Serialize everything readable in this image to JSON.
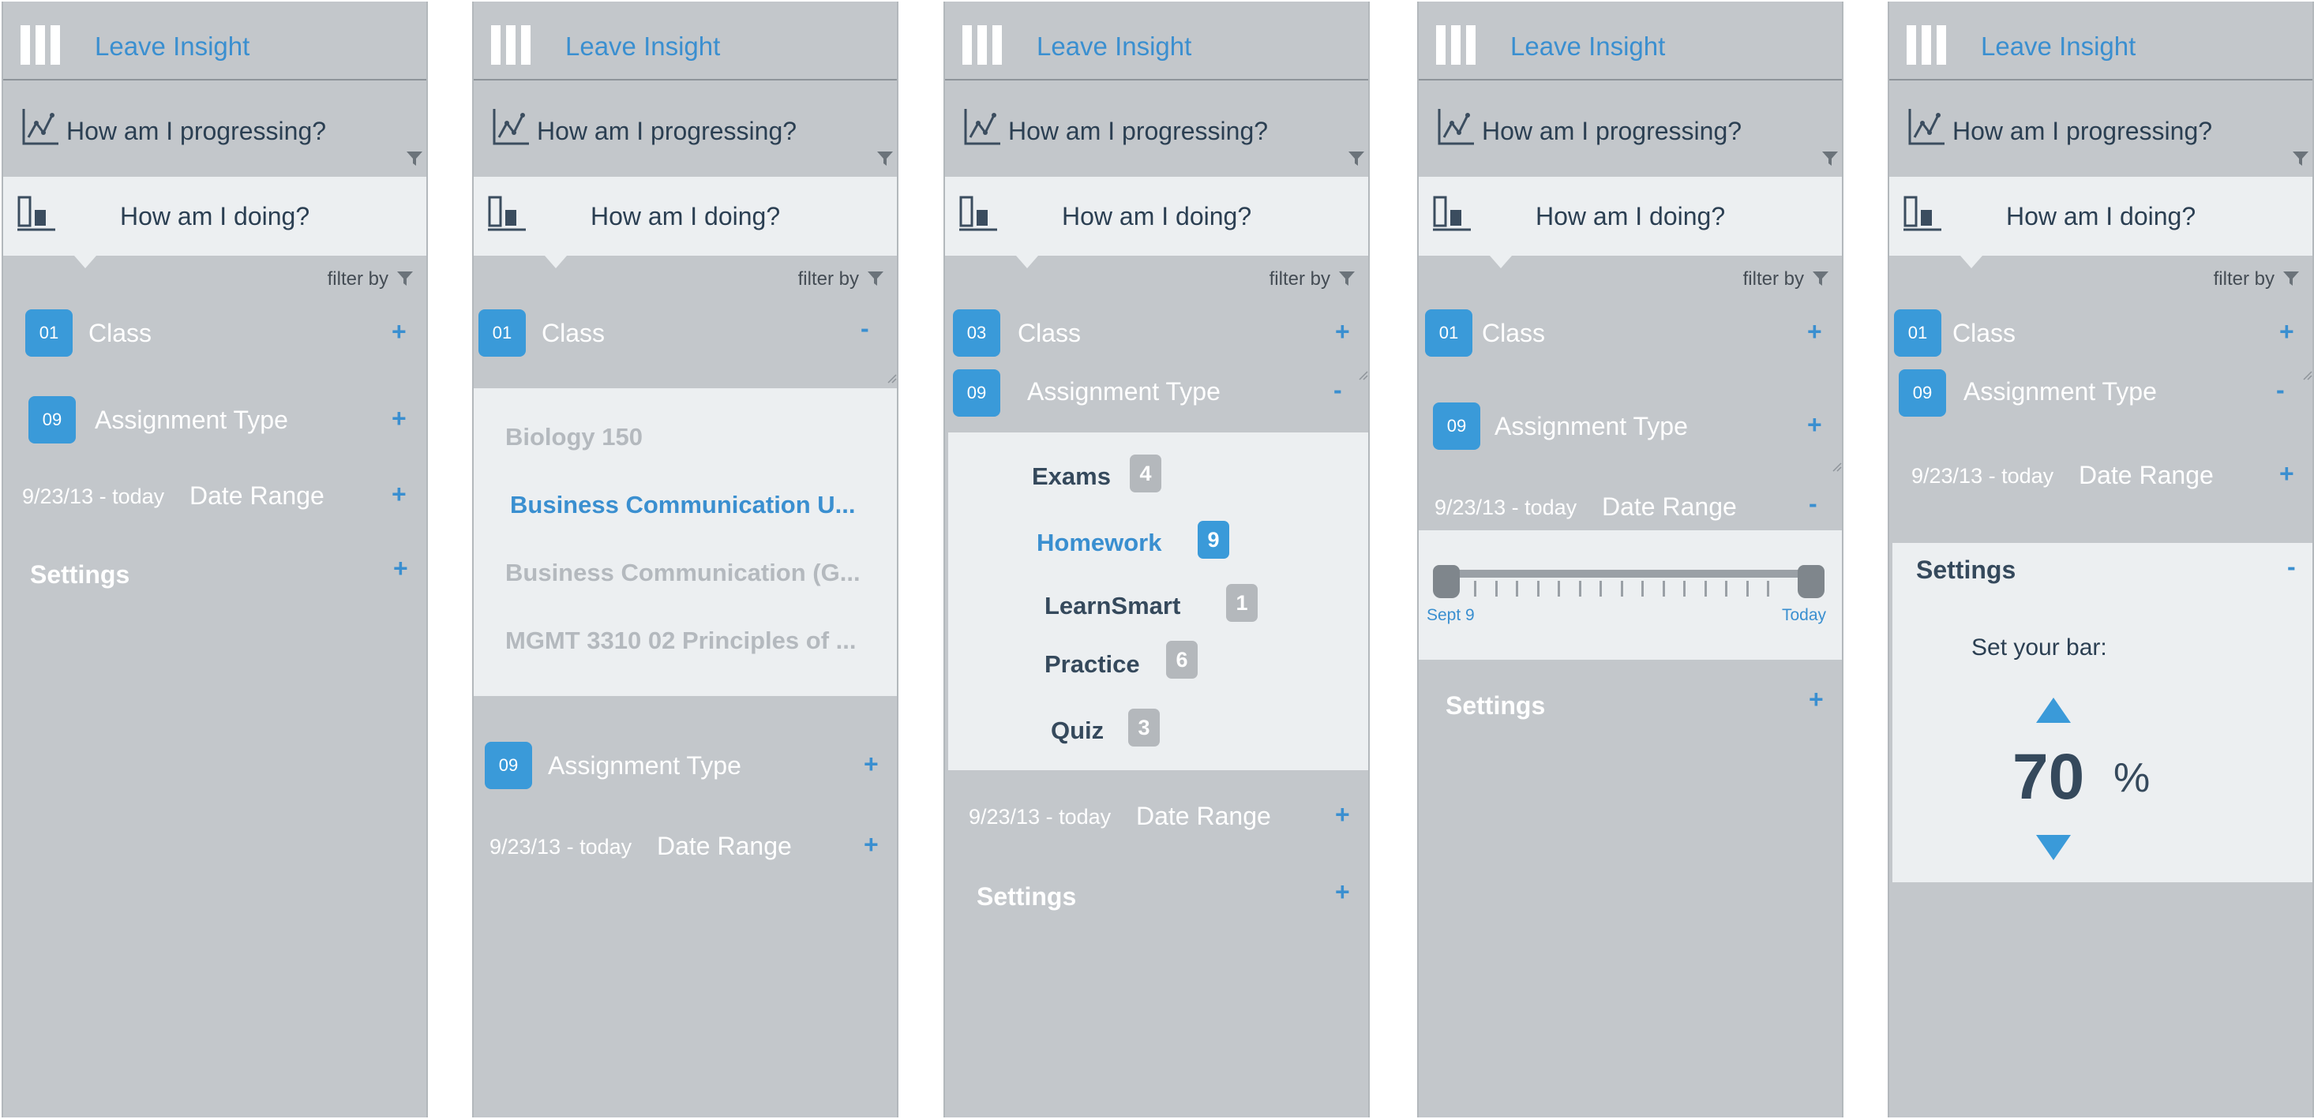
{
  "app": {
    "brand": "Leave Insight",
    "progress_label": "How am I progressing?",
    "doing_label": "How am I doing?",
    "filter_by": "filter by"
  },
  "common": {
    "class_label": "Class",
    "assignment_type_label": "Assignment Type",
    "date_range_label": "Date Range",
    "date_range_value": "9/23/13 - today",
    "settings_label": "Settings",
    "expand": "+",
    "collapse": "-"
  },
  "screens": [
    {
      "class_badge": "01",
      "assignment_badge": "09"
    },
    {
      "class_badge": "01",
      "assignment_badge": "09",
      "class_options": [
        {
          "label": "Biology 150",
          "selected": false
        },
        {
          "label": "Business Communication U...",
          "selected": true
        },
        {
          "label": "Business Communication (G...",
          "selected": false
        },
        {
          "label": "MGMT 3310 02 Principles of ...",
          "selected": false
        }
      ]
    },
    {
      "class_badge": "03",
      "assignment_badge": "09",
      "assignment_types": [
        {
          "label": "Exams",
          "count": "4",
          "selected": false
        },
        {
          "label": "Homework",
          "count": "9",
          "selected": true
        },
        {
          "label": "LearnSmart",
          "count": "1",
          "selected": false
        },
        {
          "label": "Practice",
          "count": "6",
          "selected": false
        },
        {
          "label": "Quiz",
          "count": "3",
          "selected": false
        }
      ]
    },
    {
      "class_badge": "01",
      "assignment_badge": "09",
      "slider": {
        "start_label": "Sept 9",
        "end_label": "Today"
      }
    },
    {
      "class_badge": "01",
      "assignment_badge": "09",
      "settings_panel": {
        "prompt": "Set your  bar:",
        "value": "70",
        "unit": "%"
      }
    }
  ],
  "colors": {
    "accent": "#3a9ad9",
    "panel_bg": "#c3c7cb",
    "expanded_bg": "#eceff1",
    "dark_text": "#35495c"
  },
  "icons": [
    "menu-bars-icon",
    "line-chart-icon",
    "bar-chart-icon",
    "filter-funnel-icon",
    "resize-grip-icon",
    "arrow-up-icon",
    "arrow-down-icon"
  ]
}
